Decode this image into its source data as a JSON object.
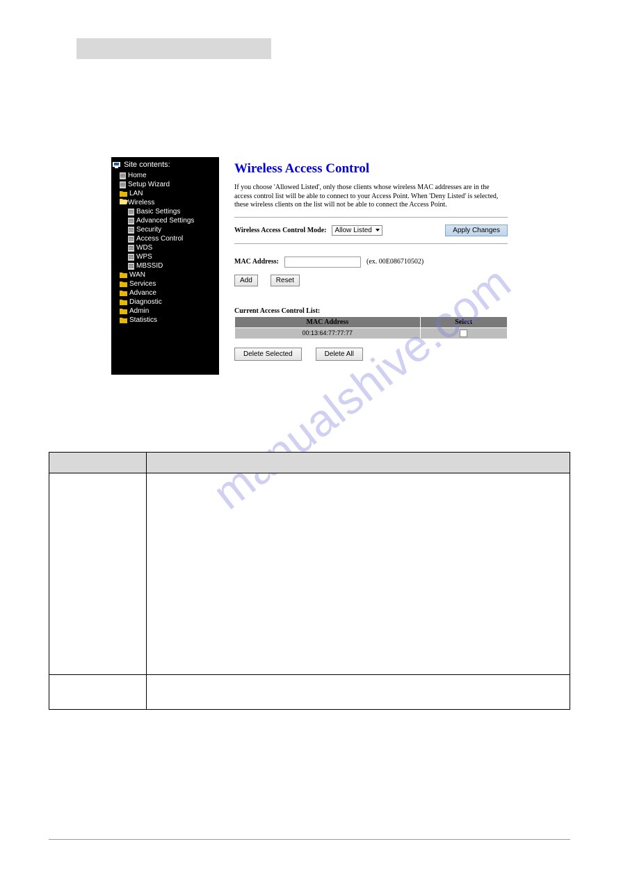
{
  "sidebar": {
    "title": "Site contents:",
    "items": [
      {
        "label": "Home",
        "icon": "page",
        "indent": 1
      },
      {
        "label": "Setup Wizard",
        "icon": "page",
        "indent": 1
      },
      {
        "label": "LAN",
        "icon": "folder",
        "indent": 1
      },
      {
        "label": "Wireless",
        "icon": "folder-open",
        "indent": 1
      },
      {
        "label": "Basic Settings",
        "icon": "page",
        "indent": 2
      },
      {
        "label": "Advanced Settings",
        "icon": "page",
        "indent": 2
      },
      {
        "label": "Security",
        "icon": "page",
        "indent": 2
      },
      {
        "label": "Access Control",
        "icon": "page",
        "indent": 2
      },
      {
        "label": "WDS",
        "icon": "page",
        "indent": 2
      },
      {
        "label": "WPS",
        "icon": "page",
        "indent": 2
      },
      {
        "label": "MBSSID",
        "icon": "page",
        "indent": 2
      },
      {
        "label": "WAN",
        "icon": "folder",
        "indent": 1
      },
      {
        "label": "Services",
        "icon": "folder",
        "indent": 1
      },
      {
        "label": "Advance",
        "icon": "folder",
        "indent": 1
      },
      {
        "label": "Diagnostic",
        "icon": "folder",
        "indent": 1
      },
      {
        "label": "Admin",
        "icon": "folder",
        "indent": 1
      },
      {
        "label": "Statistics",
        "icon": "folder",
        "indent": 1
      }
    ]
  },
  "main": {
    "title": "Wireless Access Control",
    "description": "If you choose 'Allowed Listed', only those clients whose wireless MAC addresses are in the access control list will be able to connect to your Access Point. When 'Deny Listed' is selected, these wireless clients on the list will not be able to connect the Access Point.",
    "mode_label": "Wireless Access Control Mode:",
    "mode_value": "Allow Listed",
    "apply_label": "Apply Changes",
    "mac_label": "MAC Address:",
    "mac_hint": "(ex. 00E086710502)",
    "add_label": "Add",
    "reset_label": "Reset",
    "acl_title": "Current Access Control List:",
    "acl_headers": {
      "mac": "MAC Address",
      "select": "Select"
    },
    "acl_rows": [
      {
        "mac": "00:13:64:77:77:77"
      }
    ],
    "delete_selected_label": "Delete Selected",
    "delete_all_label": "Delete All"
  },
  "watermark": "manualshive.com"
}
